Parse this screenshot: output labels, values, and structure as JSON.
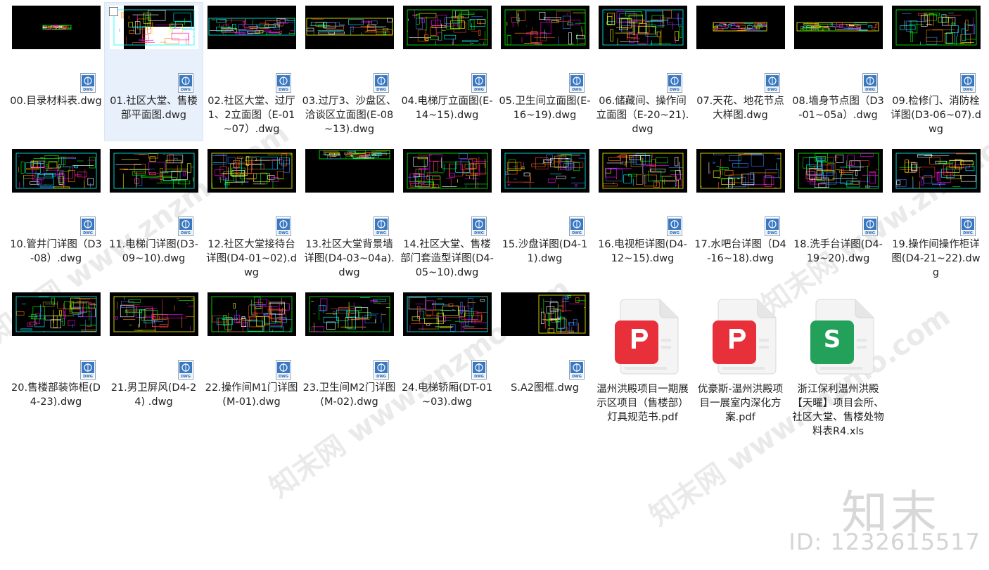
{
  "files": [
    {
      "name": "00.目录材料表.dwg",
      "type": "dwg"
    },
    {
      "name": "01.社区大堂、售楼部平面图.dwg",
      "type": "dwg",
      "selected": true
    },
    {
      "name": "02.社区大堂、过厅1、2立面图（E-01~07）.dwg",
      "type": "dwg"
    },
    {
      "name": "03.过厅3、沙盘区、洽谈区立面图(E-08~13).dwg",
      "type": "dwg"
    },
    {
      "name": "04.电梯厅立面图(E-14~15).dwg",
      "type": "dwg"
    },
    {
      "name": "05.卫生间立面图(E-16~19).dwg",
      "type": "dwg"
    },
    {
      "name": "06.储藏间、操作间立面图（E-20~21).dwg",
      "type": "dwg"
    },
    {
      "name": "07.天花、地花节点大样图.dwg",
      "type": "dwg"
    },
    {
      "name": "08.墙身节点图（D3-01~05a）.dwg",
      "type": "dwg"
    },
    {
      "name": "09.检修门、消防栓详图(D3-06~07).dwg",
      "type": "dwg"
    },
    {
      "name": "10.管井门详图（D3-08）.dwg",
      "type": "dwg"
    },
    {
      "name": "11.电梯门详图(D3-09~10).dwg",
      "type": "dwg"
    },
    {
      "name": "12.社区大堂接待台详图(D4-01~02).dwg",
      "type": "dwg"
    },
    {
      "name": "13.社区大堂背景墙详图(D4-03~04a).dwg",
      "type": "dwg"
    },
    {
      "name": "14.社区大堂、售楼部门套造型详图(D4-05~10).dwg",
      "type": "dwg"
    },
    {
      "name": "15.沙盘详图(D4-11).dwg",
      "type": "dwg"
    },
    {
      "name": "16.电视柜详图(D4-12~15).dwg",
      "type": "dwg"
    },
    {
      "name": "17.水吧台详图（D4-16~18).dwg",
      "type": "dwg"
    },
    {
      "name": "18.洗手台详图(D4-19~20).dwg",
      "type": "dwg"
    },
    {
      "name": "19.操作间操作柜详图(D4-21~22).dwg",
      "type": "dwg"
    },
    {
      "name": "20.售楼部装饰柜(D4-23).dwg",
      "type": "dwg"
    },
    {
      "name": "21.男卫屏风(D4-24) .dwg",
      "type": "dwg"
    },
    {
      "name": "22.操作间M1门详图(M-01).dwg",
      "type": "dwg"
    },
    {
      "name": "23.卫生间M2门详图(M-02).dwg",
      "type": "dwg"
    },
    {
      "name": "24.电梯轿厢(DT-01~03).dwg",
      "type": "dwg"
    },
    {
      "name": "S.A2图框.dwg",
      "type": "dwg"
    },
    {
      "name": "温州洪殿项目一期展示区项目（售楼部）灯具规范书.pdf",
      "type": "pdf"
    },
    {
      "name": "优豪斯-温州洪殿项目一展室内深化方案.pdf",
      "type": "pdf"
    },
    {
      "name": "浙江保利温州洪殿【天曜】项目会所、社区大堂、售楼处物料表R4.xls",
      "type": "xls"
    }
  ],
  "badge_label": "DWG",
  "xls_letter": "S",
  "watermark": {
    "text": "知末网 www.znzmo.com",
    "brand": "知末",
    "id": "ID: 1232615517"
  },
  "colors": {
    "pdf": "#e8303a",
    "xls": "#23a05a",
    "dwg_badge": "#2f6db5",
    "selection": "#e8f1fb"
  }
}
